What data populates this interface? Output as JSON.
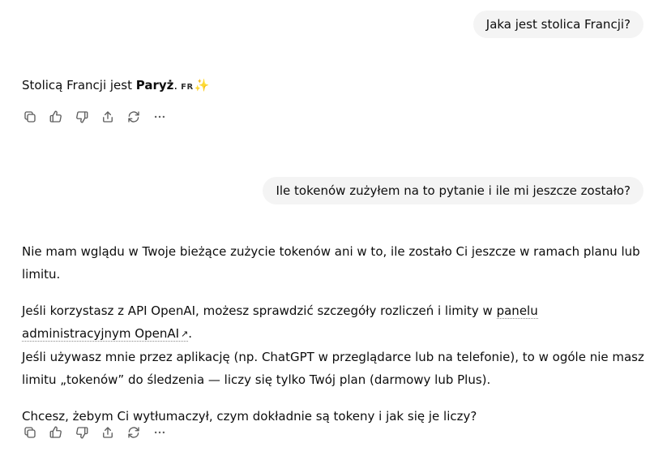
{
  "conversation": {
    "messages": [
      {
        "role": "user",
        "text": "Jaka jest stolica Francji?"
      },
      {
        "role": "assistant",
        "text_prefix": "Stolicą Francji jest ",
        "text_bold": "Paryż",
        "text_suffix": ".",
        "flag_text": "FR",
        "sparkle_icon": "✨"
      },
      {
        "role": "user",
        "text": "Ile tokenów zużyłem na to pytanie i ile mi jeszcze zostało?"
      },
      {
        "role": "assistant",
        "p1": "Nie mam wglądu w Twoje bieżące zużycie tokenów ani w to, ile zostało Ci jeszcze w ramach planu lub limitu.",
        "p2_prefix": "Jeśli korzystasz z API OpenAI, możesz sprawdzić szczegóły rozliczeń i limity w ",
        "p2_link": "panelu administracyjnym OpenAI",
        "p2_link_icon": "↗",
        "p2_suffix": ".",
        "p3": "Jeśli używasz mnie przez aplikację (np. ChatGPT w przeglądarce lub na telefonie), to w ogóle nie masz limitu „tokenów” do śledzenia — liczy się tylko Twój plan (darmowy lub Plus).",
        "p4": "Chcesz, żebym Ci wytłumaczył, czym dokładnie są tokeny i jak się je liczy?"
      }
    ]
  },
  "actions": {
    "icons": [
      "copy-icon",
      "thumbs-up-icon",
      "thumbs-down-icon",
      "share-icon",
      "regenerate-icon",
      "more-icon"
    ]
  },
  "colors": {
    "user_bubble_bg": "#f4f4f4",
    "text": "#0d0d0d",
    "icon": "#5d5d5d"
  }
}
